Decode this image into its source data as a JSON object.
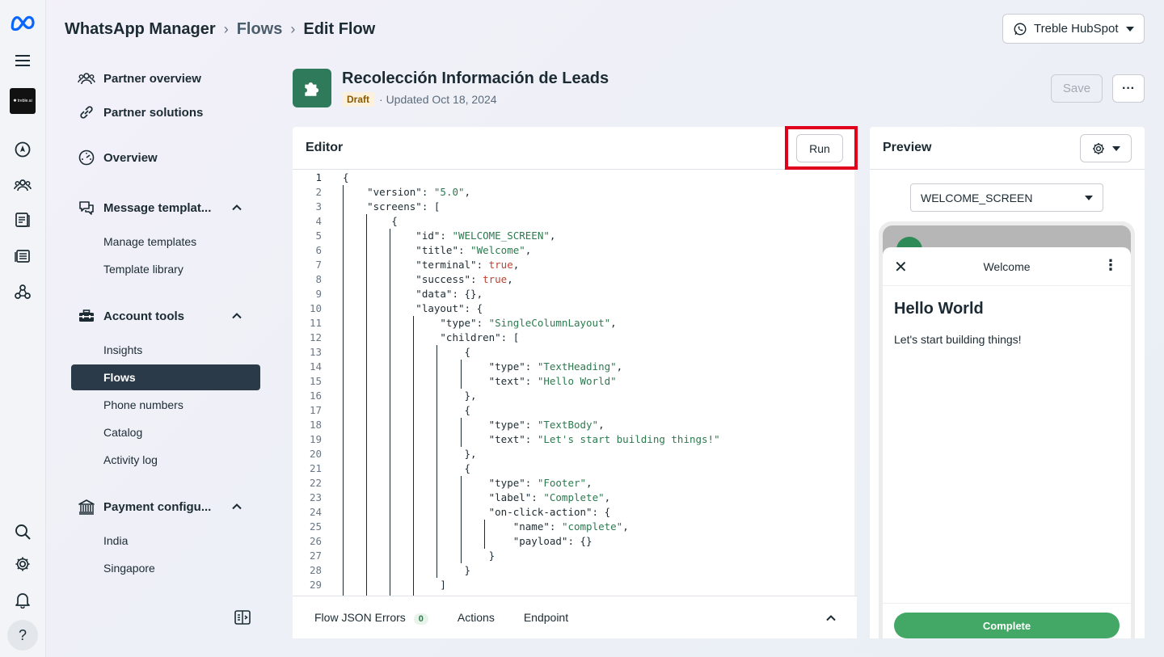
{
  "header": {
    "breadcrumbs": [
      "WhatsApp Manager",
      "Flows",
      "Edit Flow"
    ],
    "account_name": "Treble HubSpot"
  },
  "rail": {
    "icons": [
      "meta-logo-icon",
      "hamburger-menu-icon",
      "business-avatar",
      "compass-icon",
      "people-icon",
      "book-icon",
      "list-icon",
      "network-icon",
      "search-icon",
      "gear-icon",
      "bell-icon",
      "help-icon"
    ],
    "brand_tile_text": "✱ treble.ai",
    "help_label": "?"
  },
  "sidebar": {
    "items": [
      {
        "label": "Partner overview",
        "icon": "people-icon"
      },
      {
        "label": "Partner solutions",
        "icon": "link-icon"
      },
      {
        "label": "Overview",
        "icon": "gauge-icon"
      },
      {
        "label": "Message templat...",
        "icon": "chat-icon",
        "expanded": true
      },
      {
        "label": "Manage templates"
      },
      {
        "label": "Template library"
      },
      {
        "label": "Account tools",
        "icon": "toolbox-icon",
        "expanded": true
      },
      {
        "label": "Insights"
      },
      {
        "label": "Flows",
        "active": true
      },
      {
        "label": "Phone numbers"
      },
      {
        "label": "Catalog"
      },
      {
        "label": "Activity log"
      },
      {
        "label": "Payment configu...",
        "icon": "bank-icon",
        "expanded": true
      },
      {
        "label": "India"
      },
      {
        "label": "Singapore"
      }
    ]
  },
  "flow": {
    "title": "Recolección Información de Leads",
    "status": "Draft",
    "updated": "· Updated Oct 18, 2024",
    "save_label": "Save",
    "more_label": "···"
  },
  "editor": {
    "title": "Editor",
    "run_label": "Run",
    "code_lines": [
      "{",
      "    \"version\": \"5.0\",",
      "    \"screens\": [",
      "        {",
      "            \"id\": \"WELCOME_SCREEN\",",
      "            \"title\": \"Welcome\",",
      "            \"terminal\": true,",
      "            \"success\": true,",
      "            \"data\": {},",
      "            \"layout\": {",
      "                \"type\": \"SingleColumnLayout\",",
      "                \"children\": [",
      "                    {",
      "                        \"type\": \"TextHeading\",",
      "                        \"text\": \"Hello World\"",
      "                    },",
      "                    {",
      "                        \"type\": \"TextBody\",",
      "                        \"text\": \"Let's start building things!\"",
      "                    },",
      "                    {",
      "                        \"type\": \"Footer\",",
      "                        \"label\": \"Complete\",",
      "                        \"on-click-action\": {",
      "                            \"name\": \"complete\",",
      "                            \"payload\": {}",
      "                        }",
      "                    }",
      "                ]"
    ],
    "tabs": [
      {
        "label": "Flow JSON Errors",
        "count": "0"
      },
      {
        "label": "Actions"
      },
      {
        "label": "Endpoint"
      }
    ]
  },
  "preview": {
    "title": "Preview",
    "screen_select": "WELCOME_SCREEN",
    "screen_title": "Welcome",
    "heading": "Hello World",
    "body": "Let's start building things!",
    "footer_button": "Complete"
  },
  "colors": {
    "accent_dark": "#2b3a48",
    "brand_green": "#2f7a5b",
    "button_green": "#43a765",
    "highlight_red": "#e0001b"
  }
}
